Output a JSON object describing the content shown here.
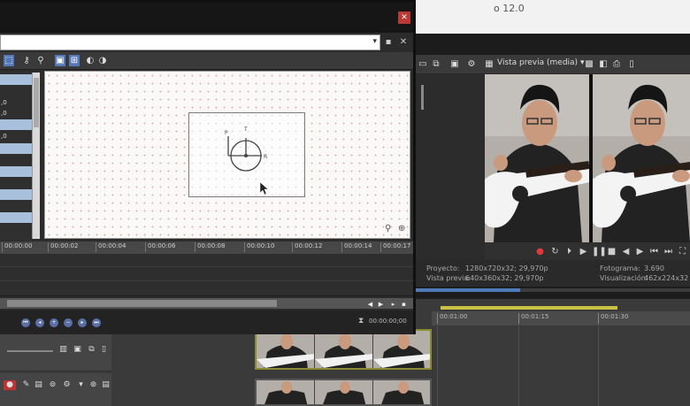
{
  "main_window": {
    "title": "o 12.0",
    "preview_mode": "Vista previa (media)",
    "preview_chevron": "▾"
  },
  "info": {
    "project_label": "Proyecto:",
    "project_value": "1280x720x32; 29,970p",
    "preview_label": "Vista previa:",
    "preview_value": "640x360x32; 29,970p",
    "frame_label": "Fotograma:",
    "frame_value": "3.690",
    "display_label": "Visualización:",
    "display_value": "462x224x32"
  },
  "playback_progress_percent": 38,
  "timeline_ruler": [
    "00:01:00",
    "00:01:15",
    "00:01:30"
  ],
  "dialog": {
    "close_glyph": "✕",
    "preset_chevron": "▾",
    "save_glyph": "▪",
    "delete_glyph": "✕",
    "params": [
      "",
      "",
      ",0",
      ",0",
      "",
      ",0",
      "",
      "",
      "",
      "",
      "",
      "",
      "",
      "",
      ""
    ],
    "keyframe_ruler": [
      "00:00:00",
      "00:00:02",
      "00:00:04",
      "00:00:06",
      "00:00:08",
      "00:00:10",
      "00:00:12",
      "00:00:14",
      "00:00:17"
    ],
    "time_readout": "00:00:00;00",
    "pivot_labels": {
      "top": "T",
      "left": "P",
      "right": "R"
    }
  },
  "icons": {
    "main_toolbar": [
      "window-icon",
      "copy-icon",
      "monitor-icon",
      "settings-icon",
      "grid-icon",
      "camera-icon",
      "save-frame-icon"
    ],
    "transport": [
      "record-icon",
      "loop-icon",
      "play-start-icon",
      "play-icon",
      "pause-icon",
      "stop-icon",
      "prev-frame-icon",
      "next-frame-icon",
      "go-start-icon",
      "go-end-icon",
      "fullscreen-icon"
    ],
    "keyframe_buttons": [
      "first-keyframe-icon",
      "prev-keyframe-icon",
      "add-keyframe-icon",
      "remove-keyframe-icon",
      "next-keyframe-icon",
      "last-keyframe-icon"
    ]
  },
  "colors": {
    "close_button": "#b83a33",
    "selection_blue": "#a9c0dc",
    "loop_region": "#c9c245",
    "progress": "#4f7cb8"
  }
}
